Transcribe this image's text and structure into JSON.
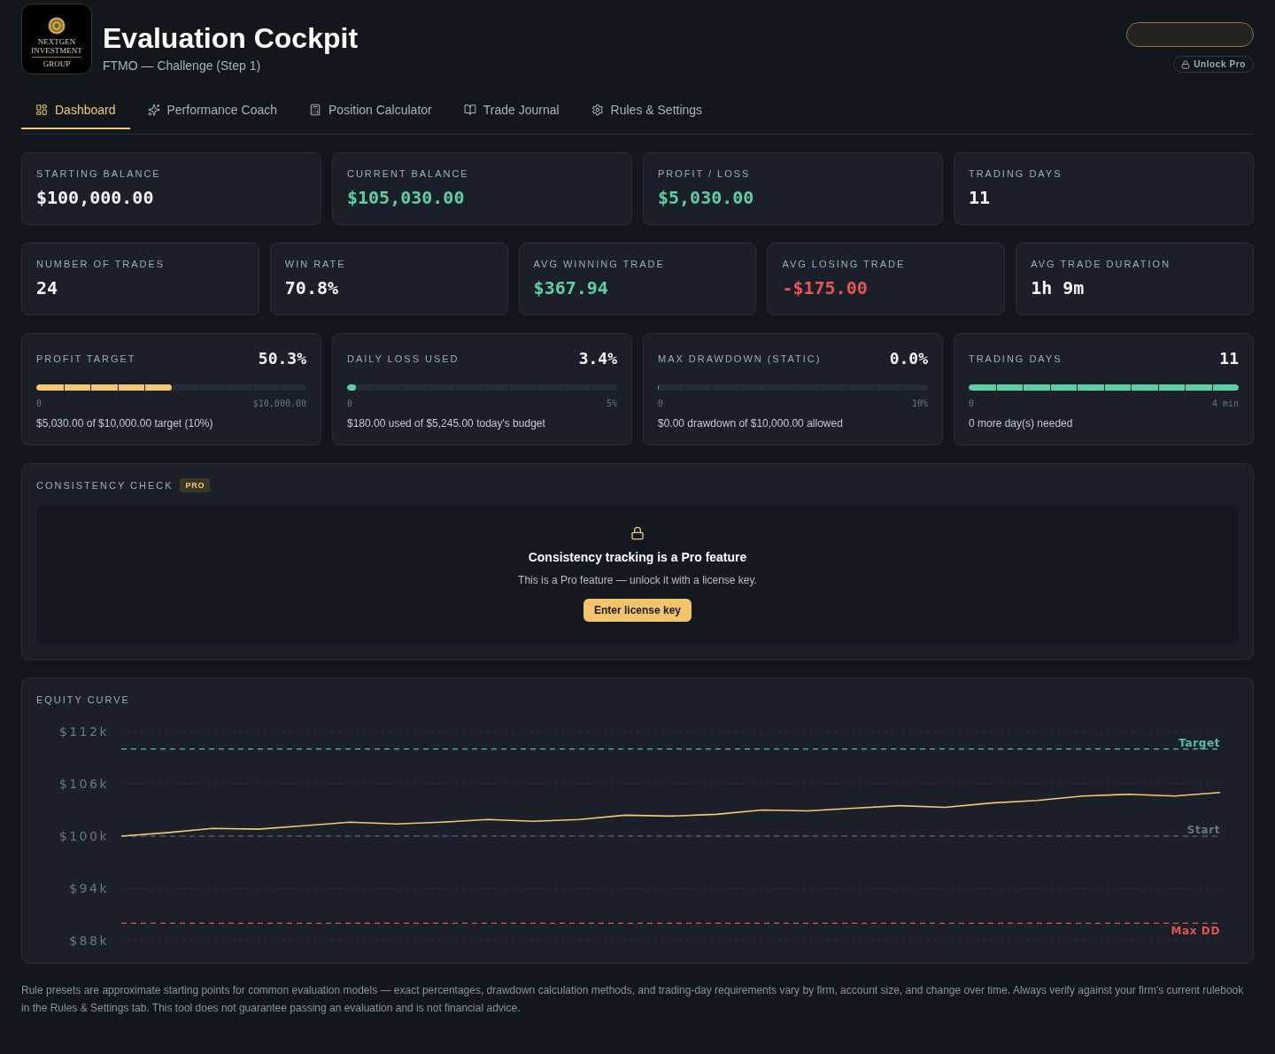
{
  "header": {
    "logo_lines": [
      "NEXTGEN INVESTMENT",
      "GROUP"
    ],
    "title": "Evaluation Cockpit",
    "subtitle": "FTMO — Challenge (Step 1)",
    "unlock_button": "Unlock Pro"
  },
  "tabs": [
    {
      "label": "Dashboard",
      "selected": true
    },
    {
      "label": "Performance Coach",
      "selected": false
    },
    {
      "label": "Position Calculator",
      "selected": false
    },
    {
      "label": "Trade Journal",
      "selected": false
    },
    {
      "label": "Rules & Settings",
      "selected": false
    }
  ],
  "summary_cards": [
    {
      "label": "STARTING BALANCE",
      "value": "$100,000.00",
      "color": "#f1f3f6"
    },
    {
      "label": "CURRENT BALANCE",
      "value": "$105,030.00",
      "color": "#5cd0a3"
    },
    {
      "label": "PROFIT / LOSS",
      "value": "$5,030.00",
      "color": "#5cd0a3"
    },
    {
      "label": "TRADING DAYS",
      "value": "11",
      "color": "#f1f3f6"
    }
  ],
  "stat_cards": [
    {
      "label": "NUMBER OF TRADES",
      "value": "24",
      "color": "#f1f3f6"
    },
    {
      "label": "WIN RATE",
      "value": "70.8%",
      "color": "#f1f3f6"
    },
    {
      "label": "AVG WINNING TRADE",
      "value": "$367.94",
      "color": "#5cd0a3"
    },
    {
      "label": "AVG LOSING TRADE",
      "value": "-$175.00",
      "color": "#e5584f"
    },
    {
      "label": "AVG TRADE DURATION",
      "value": "1h 9m",
      "color": "#f1f3f6"
    }
  ],
  "progress_cards": [
    {
      "label": "PROFIT TARGET",
      "reading": "50.3%",
      "level": 0.503,
      "color": "#f5c873",
      "scale_min": "0",
      "scale_max": "$10,000.00",
      "note": "$5,030.00 of $10,000.00 target (10%)"
    },
    {
      "label": "DAILY LOSS USED",
      "reading": "3.4%",
      "level": 0.034,
      "color": "#5cd0a3",
      "scale_min": "0",
      "scale_max": "5%",
      "note": "$180.00 used of $5,245.00 today's budget"
    },
    {
      "label": "MAX DRAWDOWN (STATIC)",
      "reading": "0.0%",
      "level": 0,
      "scale_min": "0",
      "scale_max": "10%",
      "note": "$0.00 drawdown of $10,000.00 allowed"
    },
    {
      "label": "TRADING DAYS",
      "reading": "11",
      "level": 1,
      "color": "#5cd0a3",
      "scale_min": "0",
      "scale_max": "4 min",
      "note": "0 more day(s) needed"
    }
  ],
  "consistency": {
    "title": "CONSISTENCY CHECK",
    "badge": "PRO",
    "heading": "Consistency tracking is a Pro feature",
    "message": "This is a Pro feature — unlock it with a license key.",
    "button": "Enter license key"
  },
  "equity_curve": {
    "title": "EQUITY CURVE",
    "chart_data": {
      "type": "line",
      "values": [
        100000,
        100400,
        100900,
        100800,
        101200,
        101600,
        101400,
        101600,
        101900,
        101700,
        101900,
        102400,
        102300,
        102500,
        103000,
        102900,
        103200,
        103500,
        103300,
        103800,
        104100,
        104600,
        104800,
        104600,
        105000
      ],
      "ylim": [
        88000,
        112000
      ],
      "yticks": [
        {
          "value": 88000,
          "label": "$88k"
        },
        {
          "value": 94000,
          "label": "$94k"
        },
        {
          "value": 100000,
          "label": "$100k"
        },
        {
          "value": 106000,
          "label": "$106k"
        },
        {
          "value": 112000,
          "label": "$112k"
        }
      ],
      "grid": true,
      "ref_lines": [
        {
          "axis": "y",
          "value": 110000,
          "label": "Target",
          "color": "#4cc3a6"
        },
        {
          "axis": "y",
          "value": 100000,
          "label": "Start",
          "color": "#6b7280"
        },
        {
          "axis": "y",
          "value": 90000,
          "label": "Max DD",
          "color": "#e0564d"
        }
      ]
    }
  },
  "disclaimer": "Rule presets are approximate starting points for common evaluation models — exact percentages, drawdown calculation methods, and trading-day requirements vary by firm, account size, and change over time. Always verify against your firm's current rulebook in the Rules & Settings tab. This tool does not guarantee passing an evaluation and is not financial advice."
}
